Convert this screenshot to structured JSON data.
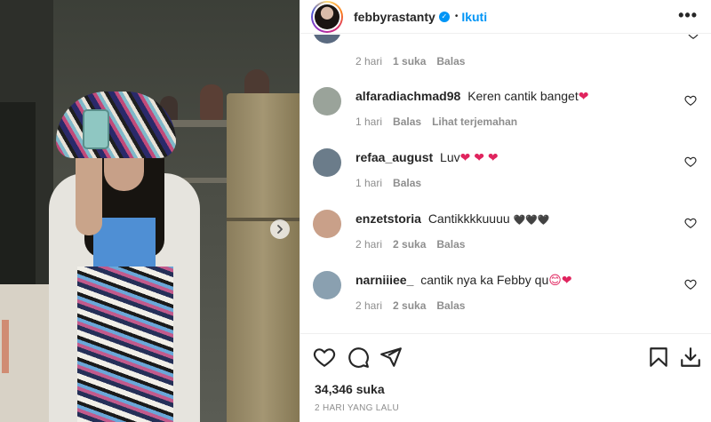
{
  "post": {
    "username": "febbyrastanty",
    "separator": "•",
    "follow_label": "Ikuti",
    "more_label": "•••",
    "likes": "34,346 suka",
    "date": "2 HARI YANG LALU"
  },
  "top_partial": {
    "time": "2 hari",
    "likes": "1 suka",
    "reply": "Balas"
  },
  "comments": [
    {
      "username": "alfaradiachmad98",
      "text": "Keren cantik banget",
      "emoji": "❤",
      "time": "1 hari",
      "reply": "Balas",
      "extra": "Lihat terjemahan",
      "avatar_color": "#9aa39a"
    },
    {
      "username": "refaa_august",
      "text": "Luv",
      "emoji": "❤ ❤ ❤",
      "time": "1 hari",
      "reply": "Balas",
      "avatar_color": "#6b7c8a"
    },
    {
      "username": "enzetstoria",
      "text": "Cantikkkkuuuu",
      "emoji": "🖤🖤🖤",
      "time": "2 hari",
      "likes": "2 suka",
      "reply": "Balas",
      "avatar_color": "#c9a089"
    },
    {
      "username": "narniiiee_",
      "text": "cantik nya ka Febby qu",
      "emoji": "😊❤",
      "time": "2 hari",
      "likes": "2 suka",
      "reply": "Balas",
      "avatar_color": "#8aa0b0"
    }
  ],
  "colors": {
    "accent": "#0095f6",
    "heart": "#e0245e",
    "muted": "#8e8e8e"
  }
}
